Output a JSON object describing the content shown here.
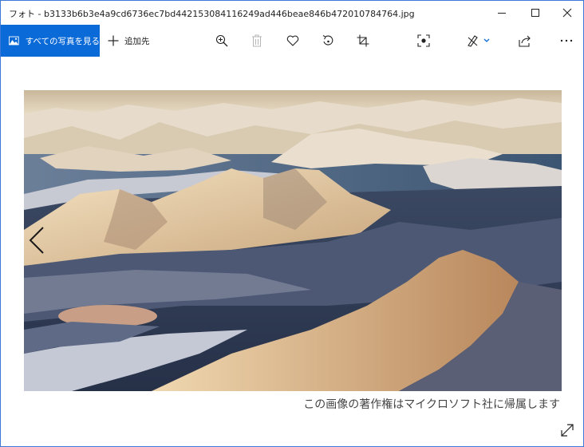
{
  "window": {
    "title": "フォト - b3133b6b3e4a9cd6736ec7bd442153084116249ad446beae846b472010784764.jpg",
    "controls": [
      "minimize",
      "maximize",
      "close"
    ]
  },
  "toolbar": {
    "all_photos_label": "すべての写真を見る",
    "add_to_label": "追加先",
    "icons": [
      "zoom-in-icon",
      "delete-icon",
      "heart-icon",
      "rotate-icon",
      "crop-icon",
      "enhance-icon",
      "edit-draw-icon",
      "share-icon",
      "more-icon"
    ],
    "accent": "#0a6ad8"
  },
  "viewer": {
    "image": "Aerial view of snow-covered mountains and fjords at sunrise",
    "copyright": "この画像の著作権はマイクロソフト社に帰属します"
  }
}
